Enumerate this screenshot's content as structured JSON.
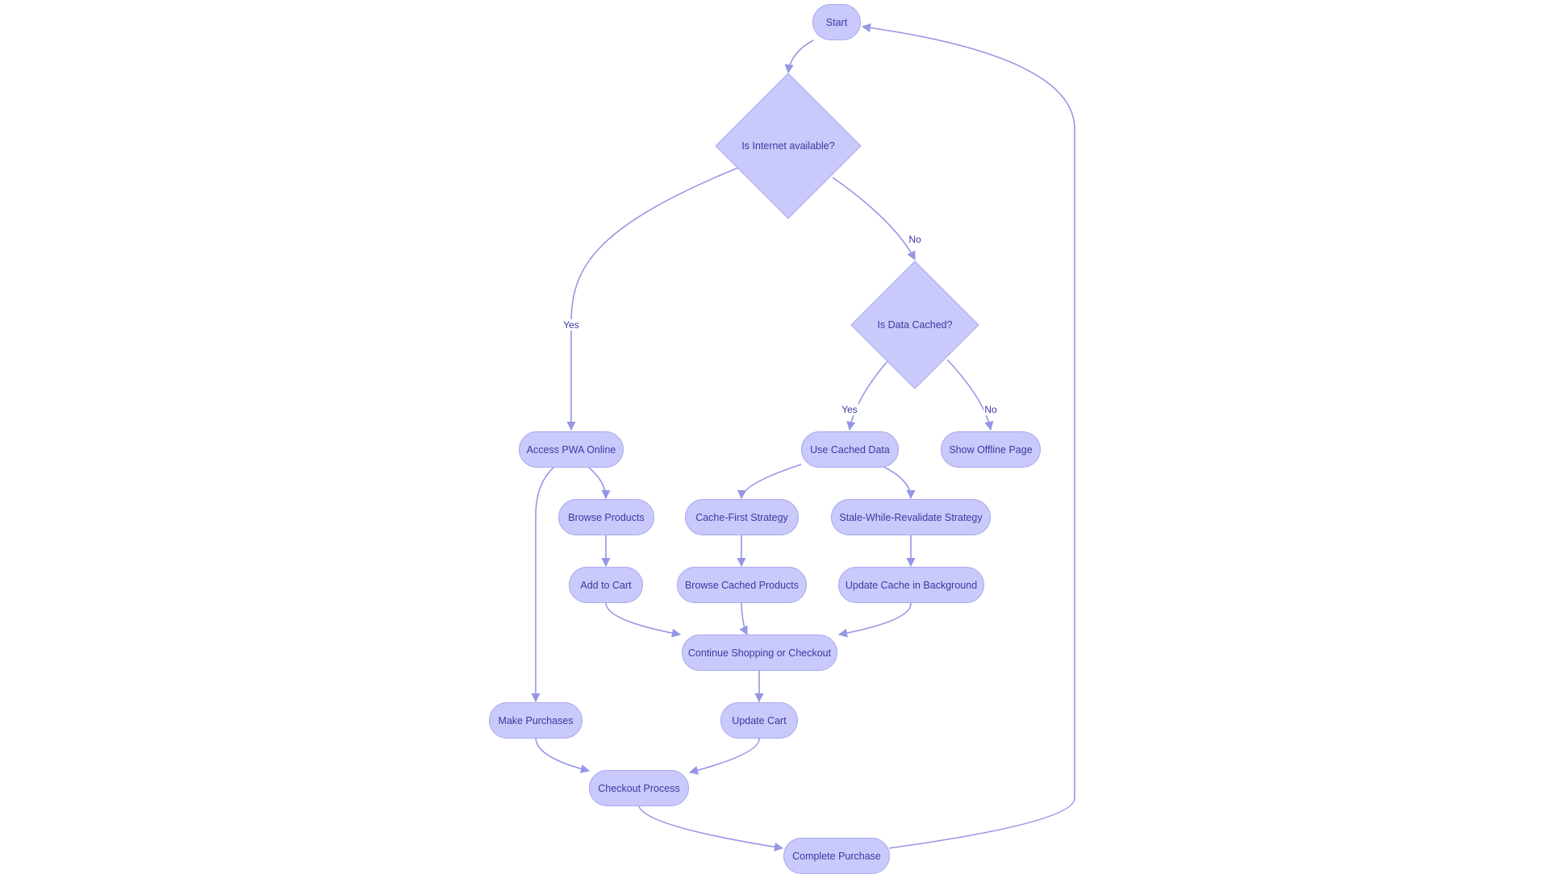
{
  "colors": {
    "node_fill": "#c9c9fc",
    "node_stroke": "#a9a9ee",
    "edge": "#9696e6",
    "text": "#3a3aa0"
  },
  "nodes": {
    "start": "Start",
    "internet": "Is Internet available?",
    "cached": "Is Data Cached?",
    "access_online": "Access PWA Online",
    "use_cached": "Use Cached Data",
    "offline_page": "Show Offline Page",
    "browse_products": "Browse Products",
    "cache_first": "Cache-First Strategy",
    "swr": "Stale-While-Revalidate Strategy",
    "add_to_cart": "Add to Cart",
    "browse_cached": "Browse Cached Products",
    "update_cache": "Update Cache in Background",
    "continue": "Continue Shopping or Checkout",
    "make_purchases": "Make Purchases",
    "update_cart": "Update Cart",
    "checkout": "Checkout Process",
    "complete": "Complete Purchase"
  },
  "edge_labels": {
    "internet_yes": "Yes",
    "internet_no": "No",
    "cached_yes": "Yes",
    "cached_no": "No"
  }
}
